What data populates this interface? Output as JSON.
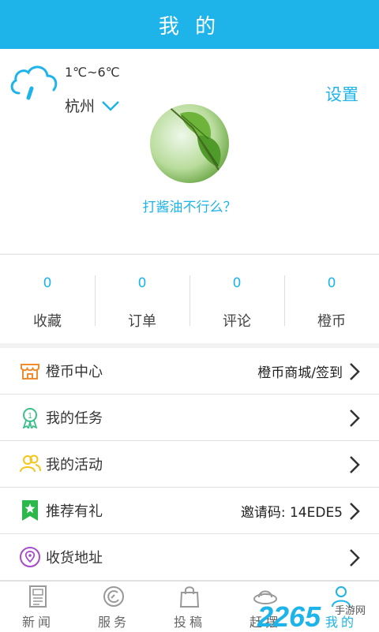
{
  "header": {
    "title": "我 的"
  },
  "weather": {
    "temperature": "1℃~6℃",
    "city": "杭州"
  },
  "settings_label": "设置",
  "user": {
    "nickname": "打酱油不行么？"
  },
  "stats": [
    {
      "count": "0",
      "label": "收藏"
    },
    {
      "count": "0",
      "label": "订单"
    },
    {
      "count": "0",
      "label": "评论"
    },
    {
      "count": "0",
      "label": "橙币"
    }
  ],
  "menu": [
    {
      "label": "橙币中心",
      "value": "橙币商城/签到",
      "icon": "shop-icon",
      "color": "#f08c2c"
    },
    {
      "label": "我的任务",
      "value": "",
      "icon": "medal-icon",
      "color": "#3cbf8a"
    },
    {
      "label": "我的活动",
      "value": "",
      "icon": "people-icon",
      "color": "#f5c518"
    },
    {
      "label": "推荐有礼",
      "value": "邀请码: 14EDE5",
      "icon": "star-bookmark-icon",
      "color": "#2db84c"
    },
    {
      "label": "收货地址",
      "value": "",
      "icon": "location-icon",
      "color": "#a64cc8"
    }
  ],
  "tabs": [
    {
      "label": "新闻",
      "icon": "newspaper-icon"
    },
    {
      "label": "服务",
      "icon": "service-icon"
    },
    {
      "label": "投稿",
      "icon": "bag-icon"
    },
    {
      "label": "赶摆",
      "icon": "hat-icon"
    },
    {
      "label": "我的",
      "icon": "person-icon",
      "active": true
    }
  ],
  "watermark": {
    "brand": "2265",
    "suffix": "手游网"
  },
  "colors": {
    "accent": "#1eb4ea"
  }
}
